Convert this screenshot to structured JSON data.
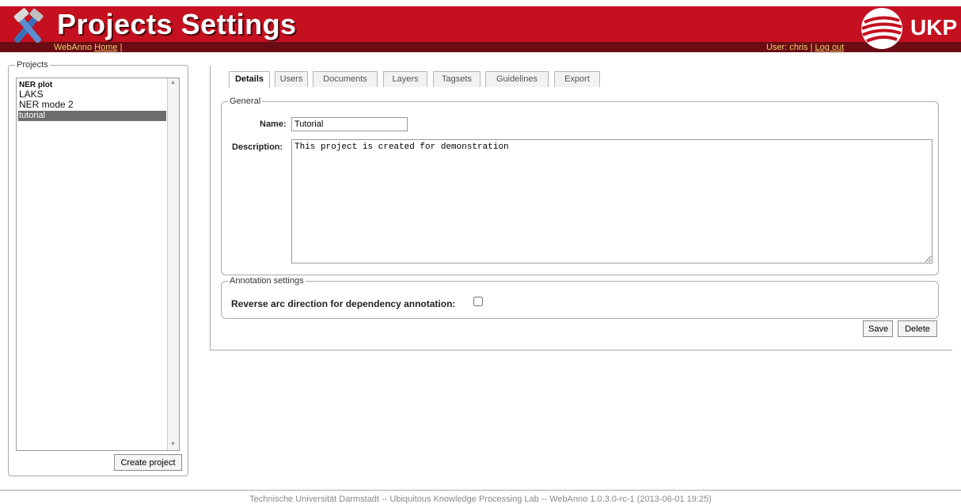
{
  "header": {
    "title": "Projects Settings",
    "app_name": "WebAnno",
    "home_link": "Home",
    "separator": "|",
    "user_label": "User: chris",
    "logout_link": "Log out",
    "brand": "UKP",
    "colors": {
      "header_red": "#c4101f",
      "header_dark": "#6b0c14",
      "link_yellow": "#e8d36b"
    },
    "logo_icon": "tools-icon",
    "brand_icon": "globe-icon"
  },
  "sidebar": {
    "legend": "Projects",
    "items": [
      {
        "label": "NER plot"
      },
      {
        "label": "LAKS"
      },
      {
        "label": "NER mode 2"
      },
      {
        "label": "tutorial",
        "selected": true
      }
    ],
    "create_button": "Create project"
  },
  "tabs": [
    {
      "label": "Details",
      "active": true
    },
    {
      "label": "Users"
    },
    {
      "label": "Documents"
    },
    {
      "label": "Layers"
    },
    {
      "label": "Tagsets"
    },
    {
      "label": "Guidelines"
    },
    {
      "label": "Export"
    }
  ],
  "general": {
    "legend": "General",
    "name_label": "Name:",
    "name_value": "Tutorial",
    "description_label": "Description:",
    "description_value": "This project is created for demonstration"
  },
  "annotation_settings": {
    "legend": "Annotation settings",
    "reverse_label": "Reverse arc direction for dependency annotation:",
    "reverse_checked": false
  },
  "actions": {
    "save": "Save",
    "delete": "Delete"
  },
  "footer": {
    "text": "Technische Universität Darmstadt -- Ubiquitous Knowledge Processing Lab -- WebAnno 1.0.3.0-rc-1 (2013-06-01 19:25)"
  }
}
